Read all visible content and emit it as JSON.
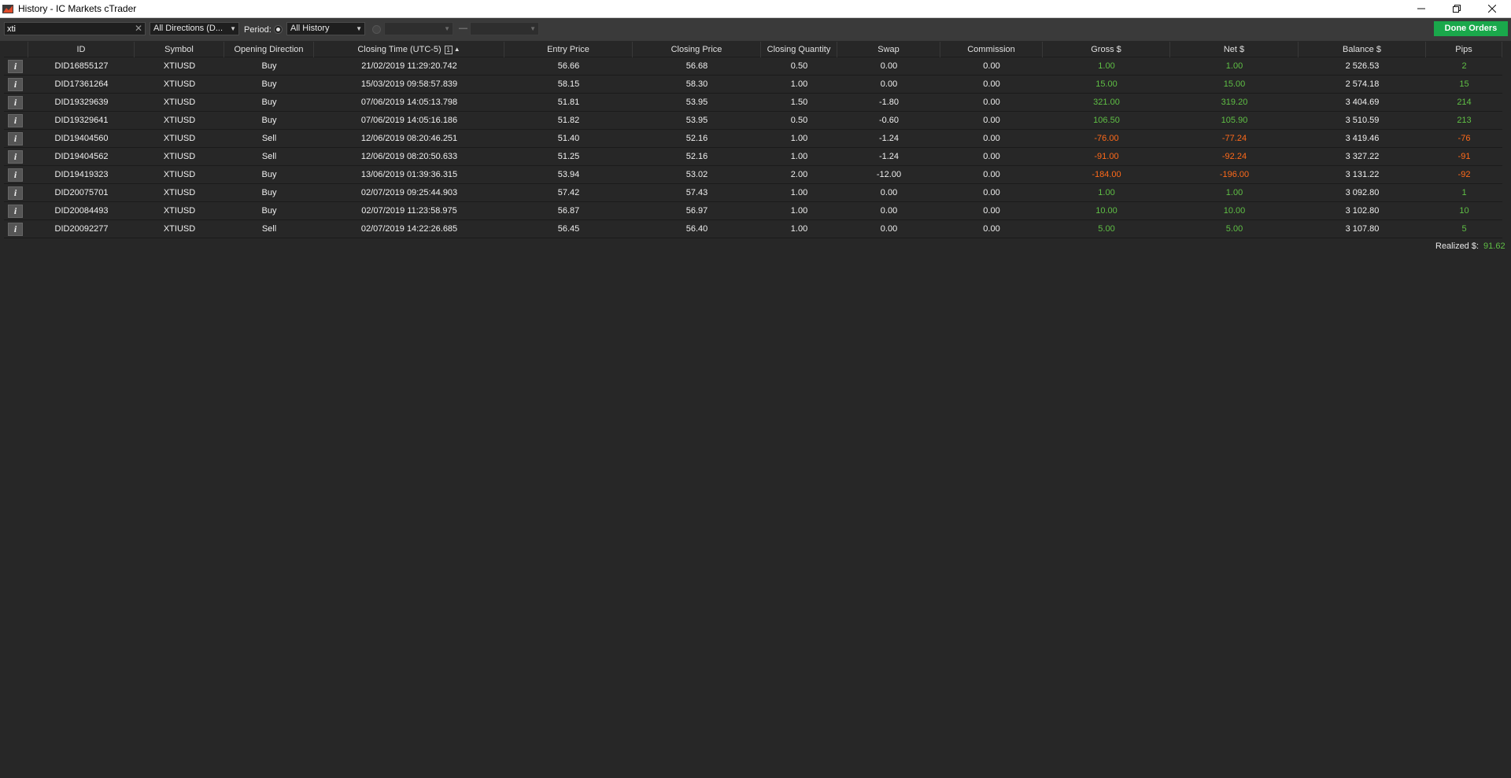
{
  "window": {
    "title": "History - IC Markets cTrader",
    "controls": [
      "minimize",
      "restore",
      "close"
    ]
  },
  "toolbar": {
    "search_value": "xti",
    "direction_filter": "All Directions (D...",
    "period_label": "Period:",
    "period_option": "All History",
    "date_from": "",
    "date_to": "",
    "range_separator": "—",
    "done_orders_label": "Done Orders"
  },
  "columns": [
    "ID",
    "Symbol",
    "Opening Direction",
    "Closing Time (UTC-5)",
    "Entry Price",
    "Closing Price",
    "Closing Quantity",
    "Swap",
    "Commission",
    "Gross $",
    "Net $",
    "Balance $",
    "Pips"
  ],
  "sort_indicator": "1",
  "rows": [
    {
      "id": "DID16855127",
      "symbol": "XTIUSD",
      "direction": "Buy",
      "closing_time": "21/02/2019 11:29:20.742",
      "entry": "56.66",
      "closing": "56.68",
      "qty": "0.50",
      "swap": "0.00",
      "commission": "0.00",
      "gross": "1.00",
      "net": "1.00",
      "balance": "2 526.53",
      "pips": "2",
      "sign": "pos"
    },
    {
      "id": "DID17361264",
      "symbol": "XTIUSD",
      "direction": "Buy",
      "closing_time": "15/03/2019 09:58:57.839",
      "entry": "58.15",
      "closing": "58.30",
      "qty": "1.00",
      "swap": "0.00",
      "commission": "0.00",
      "gross": "15.00",
      "net": "15.00",
      "balance": "2 574.18",
      "pips": "15",
      "sign": "pos"
    },
    {
      "id": "DID19329639",
      "symbol": "XTIUSD",
      "direction": "Buy",
      "closing_time": "07/06/2019 14:05:13.798",
      "entry": "51.81",
      "closing": "53.95",
      "qty": "1.50",
      "swap": "-1.80",
      "commission": "0.00",
      "gross": "321.00",
      "net": "319.20",
      "balance": "3 404.69",
      "pips": "214",
      "sign": "pos"
    },
    {
      "id": "DID19329641",
      "symbol": "XTIUSD",
      "direction": "Buy",
      "closing_time": "07/06/2019 14:05:16.186",
      "entry": "51.82",
      "closing": "53.95",
      "qty": "0.50",
      "swap": "-0.60",
      "commission": "0.00",
      "gross": "106.50",
      "net": "105.90",
      "balance": "3 510.59",
      "pips": "213",
      "sign": "pos"
    },
    {
      "id": "DID19404560",
      "symbol": "XTIUSD",
      "direction": "Sell",
      "closing_time": "12/06/2019 08:20:46.251",
      "entry": "51.40",
      "closing": "52.16",
      "qty": "1.00",
      "swap": "-1.24",
      "commission": "0.00",
      "gross": "-76.00",
      "net": "-77.24",
      "balance": "3 419.46",
      "pips": "-76",
      "sign": "neg"
    },
    {
      "id": "DID19404562",
      "symbol": "XTIUSD",
      "direction": "Sell",
      "closing_time": "12/06/2019 08:20:50.633",
      "entry": "51.25",
      "closing": "52.16",
      "qty": "1.00",
      "swap": "-1.24",
      "commission": "0.00",
      "gross": "-91.00",
      "net": "-92.24",
      "balance": "3 327.22",
      "pips": "-91",
      "sign": "neg"
    },
    {
      "id": "DID19419323",
      "symbol": "XTIUSD",
      "direction": "Buy",
      "closing_time": "13/06/2019 01:39:36.315",
      "entry": "53.94",
      "closing": "53.02",
      "qty": "2.00",
      "swap": "-12.00",
      "commission": "0.00",
      "gross": "-184.00",
      "net": "-196.00",
      "balance": "3 131.22",
      "pips": "-92",
      "sign": "neg"
    },
    {
      "id": "DID20075701",
      "symbol": "XTIUSD",
      "direction": "Buy",
      "closing_time": "02/07/2019 09:25:44.903",
      "entry": "57.42",
      "closing": "57.43",
      "qty": "1.00",
      "swap": "0.00",
      "commission": "0.00",
      "gross": "1.00",
      "net": "1.00",
      "balance": "3 092.80",
      "pips": "1",
      "sign": "pos"
    },
    {
      "id": "DID20084493",
      "symbol": "XTIUSD",
      "direction": "Buy",
      "closing_time": "02/07/2019 11:23:58.975",
      "entry": "56.87",
      "closing": "56.97",
      "qty": "1.00",
      "swap": "0.00",
      "commission": "0.00",
      "gross": "10.00",
      "net": "10.00",
      "balance": "3 102.80",
      "pips": "10",
      "sign": "pos"
    },
    {
      "id": "DID20092277",
      "symbol": "XTIUSD",
      "direction": "Sell",
      "closing_time": "02/07/2019 14:22:26.685",
      "entry": "56.45",
      "closing": "56.40",
      "qty": "1.00",
      "swap": "0.00",
      "commission": "0.00",
      "gross": "5.00",
      "net": "5.00",
      "balance": "3 107.80",
      "pips": "5",
      "sign": "pos"
    }
  ],
  "summary": {
    "realized_label": "Realized $:",
    "realized_value": "91.62"
  },
  "colors": {
    "positive": "#5fbf45",
    "negative": "#ff6a1a",
    "accent_button": "#1aa84b",
    "background": "#272727"
  }
}
